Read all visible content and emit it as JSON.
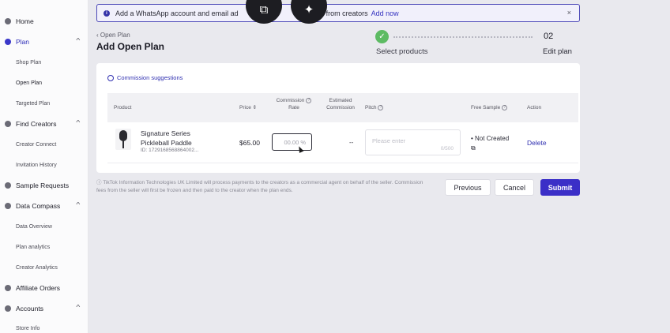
{
  "sidebar": {
    "home": "Home",
    "plan": "Plan",
    "shop_plan": "Shop Plan",
    "open_plan": "Open Plan",
    "targeted_plan": "Targeted Plan",
    "find_creators": "Find Creators",
    "creator_connect": "Creator Connect",
    "invitation_history": "Invitation History",
    "sample_requests": "Sample Requests",
    "data_compass": "Data Compass",
    "data_overview": "Data Overview",
    "plan_analytics": "Plan analytics",
    "creator_analytics": "Creator Analytics",
    "affiliate_orders": "Affiliate Orders",
    "accounts": "Accounts",
    "store_info": "Store Info"
  },
  "banner": {
    "text": "Add a WhatsApp account and email ad",
    "text_end": "ges from creators",
    "link": "Add now",
    "close": "×"
  },
  "overlay": {
    "left_icon": "⧉",
    "right_icon": "✦"
  },
  "header": {
    "back": "Open Plan",
    "title": "Add Open Plan",
    "step1_label": "Select products",
    "step2_number": "02",
    "step2_label": "Edit plan"
  },
  "card": {
    "suggestions": "Commission suggestions",
    "columns": {
      "product": "Product",
      "price": "Price",
      "commission_rate_1": "Commission",
      "commission_rate_2": "Rate",
      "est_commission_1": "Estimated",
      "est_commission_2": "Commission",
      "pitch": "Pitch",
      "free_sample": "Free Sample",
      "action": "Action"
    },
    "row": {
      "name_line1": "Signature Series",
      "name_line2": "Pickleball Paddle",
      "id": "ID: 1729168568864002...",
      "price": "$65.00",
      "rate_placeholder": "00.00 %",
      "est_commission": "--",
      "pitch_placeholder": "Please enter",
      "pitch_count": "0/500",
      "free_sample": "Not Created",
      "action": "Delete"
    }
  },
  "footer": {
    "disclaimer": "TikTok Information Technologies UK Limited will process payments to the creators as a commercial agent on behalf of the seller. Commission fees from the seller will first be frozen and then paid to the creator when the plan ends.",
    "previous": "Previous",
    "cancel": "Cancel",
    "submit": "Submit"
  },
  "colors": {
    "accent": "#3b2fc7",
    "step_done": "#5dbb63",
    "link": "#2f2fb0"
  }
}
